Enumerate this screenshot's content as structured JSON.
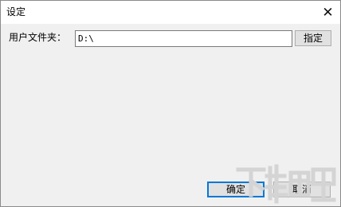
{
  "window": {
    "title": "设定",
    "close_glyph": "✕"
  },
  "form": {
    "folder_label": "用户文件夹：",
    "folder_value": "D:\\",
    "browse_label": "指定"
  },
  "footer": {
    "ok_label": "确定",
    "cancel_label": "取消"
  }
}
